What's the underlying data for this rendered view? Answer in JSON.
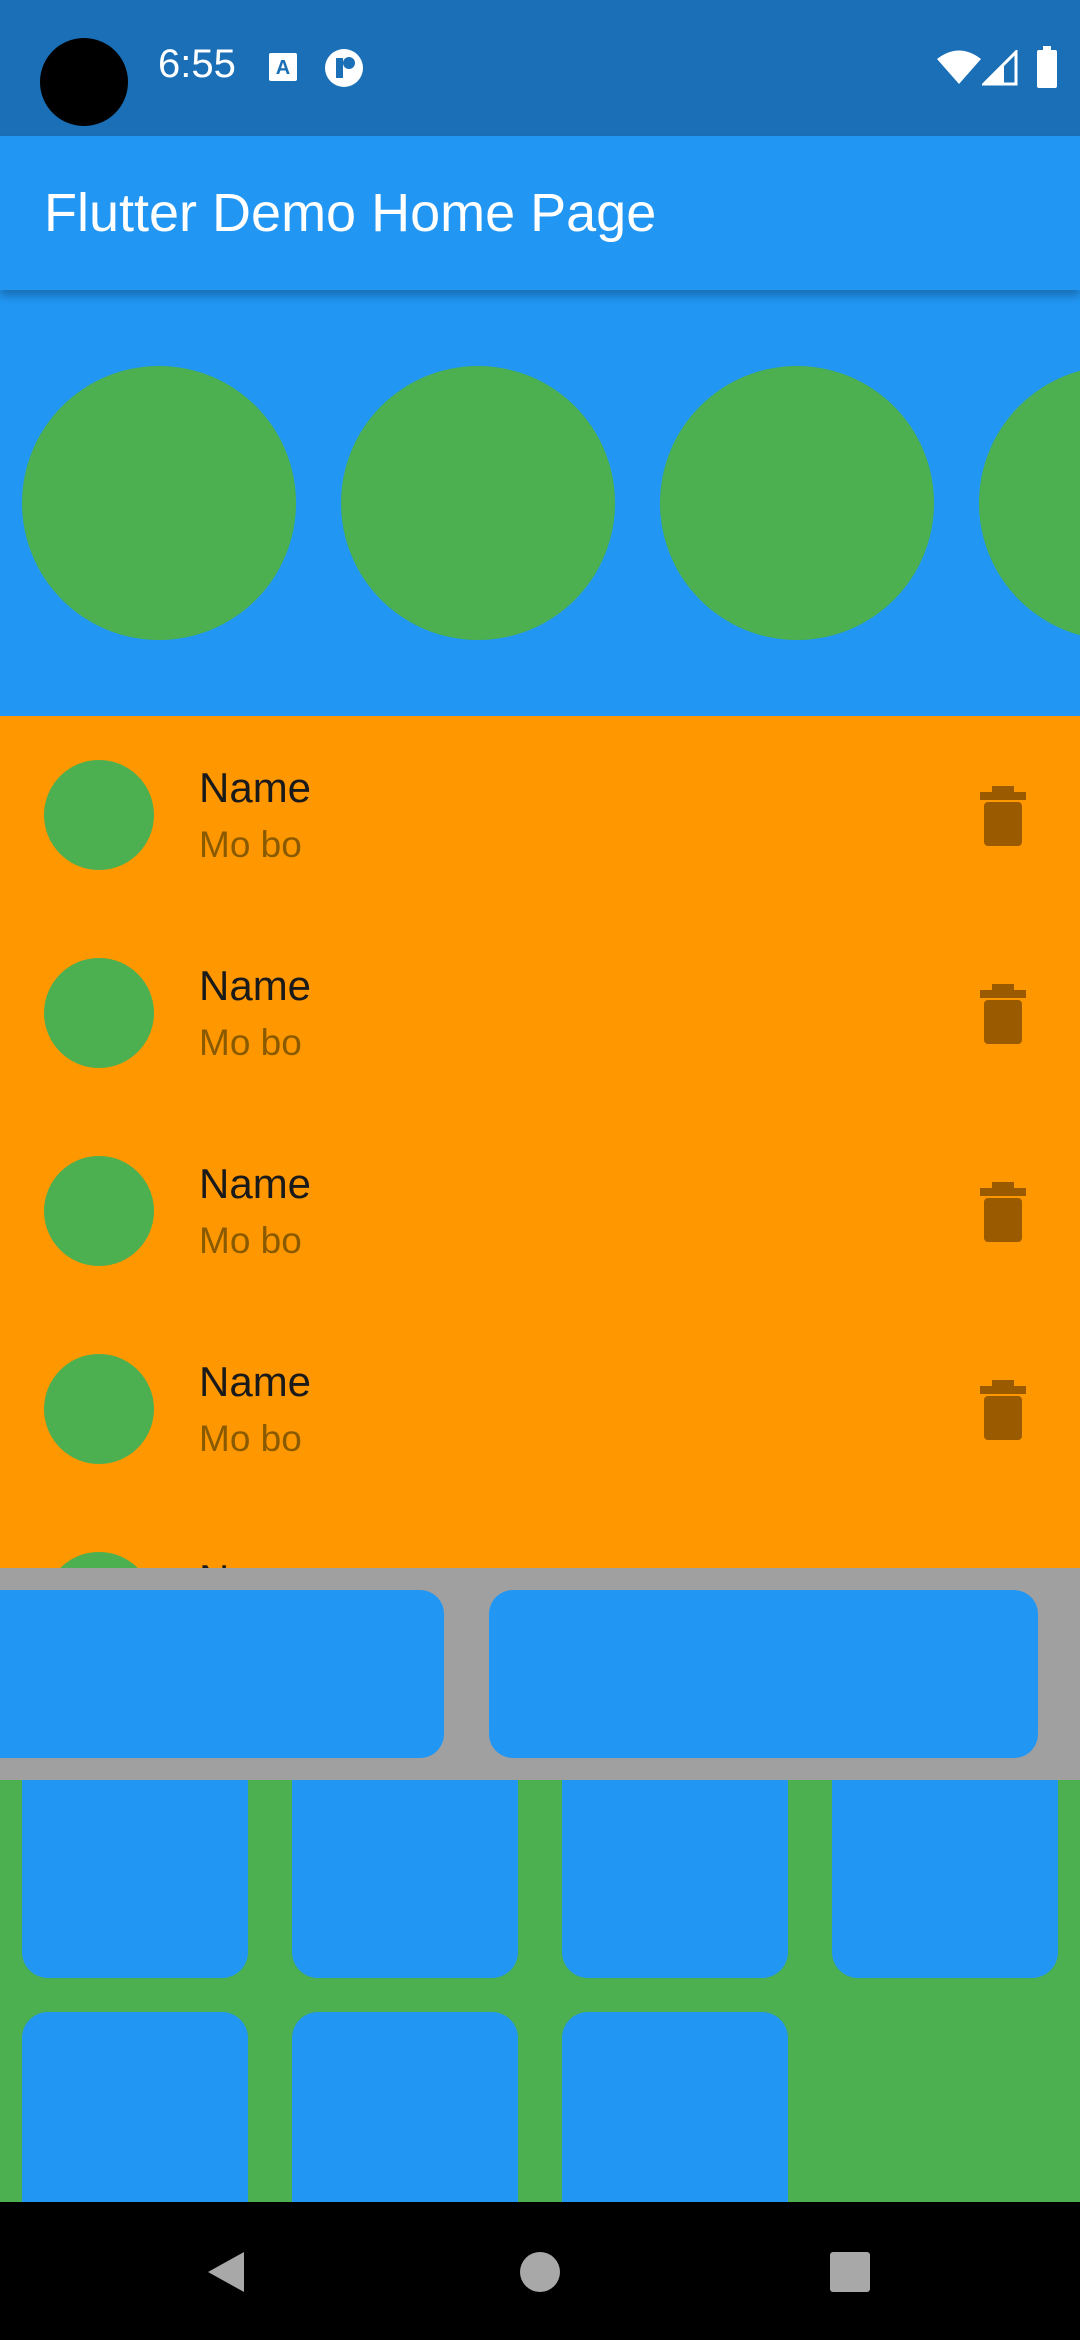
{
  "status_bar": {
    "time": "6:55",
    "left_icons": [
      "accessibility-a-icon",
      "app-notification-icon"
    ],
    "right_icons": [
      "wifi-icon",
      "cellular-signal-icon",
      "battery-icon"
    ]
  },
  "app_bar": {
    "title": "Flutter Demo Home Page"
  },
  "colors": {
    "status_bar": "#1a6fb6",
    "primary": "#2196f3",
    "green": "#4caf50",
    "orange": "#ff9800",
    "grey": "#a0a0a0",
    "delete_icon": "#9a5a00"
  },
  "list": {
    "items": [
      {
        "title": "Name",
        "subtitle": "Mo bo"
      },
      {
        "title": "Name",
        "subtitle": "Mo bo"
      },
      {
        "title": "Name",
        "subtitle": "Mo bo"
      },
      {
        "title": "Name",
        "subtitle": "Mo bo"
      },
      {
        "title": "Name",
        "subtitle": ""
      }
    ]
  },
  "nav_bar": {
    "icons": [
      "back-icon",
      "home-icon",
      "recents-icon"
    ]
  }
}
